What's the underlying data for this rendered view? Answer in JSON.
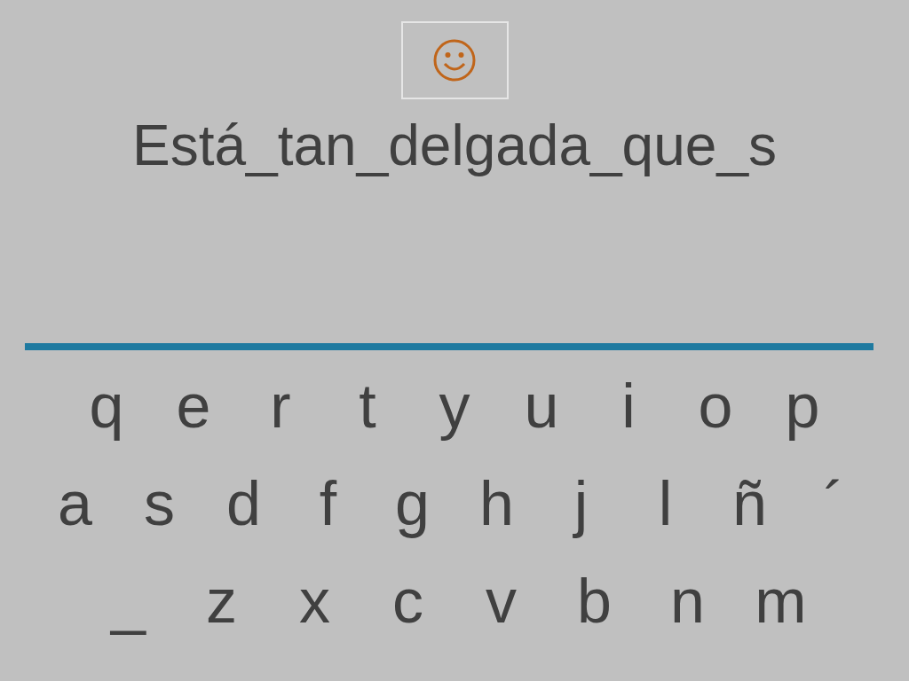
{
  "sentence": "Está_tan_delgada_que_s",
  "keyboard": {
    "rows": [
      [
        "q",
        "e",
        "r",
        "t",
        "y",
        "u",
        "i",
        "o",
        "p"
      ],
      [
        "a",
        "s",
        "d",
        "f",
        "g",
        "h",
        "j",
        "l",
        "ñ",
        "´"
      ],
      [
        "_",
        "z",
        "x",
        "c",
        "v",
        "b",
        "n",
        "m"
      ]
    ]
  }
}
